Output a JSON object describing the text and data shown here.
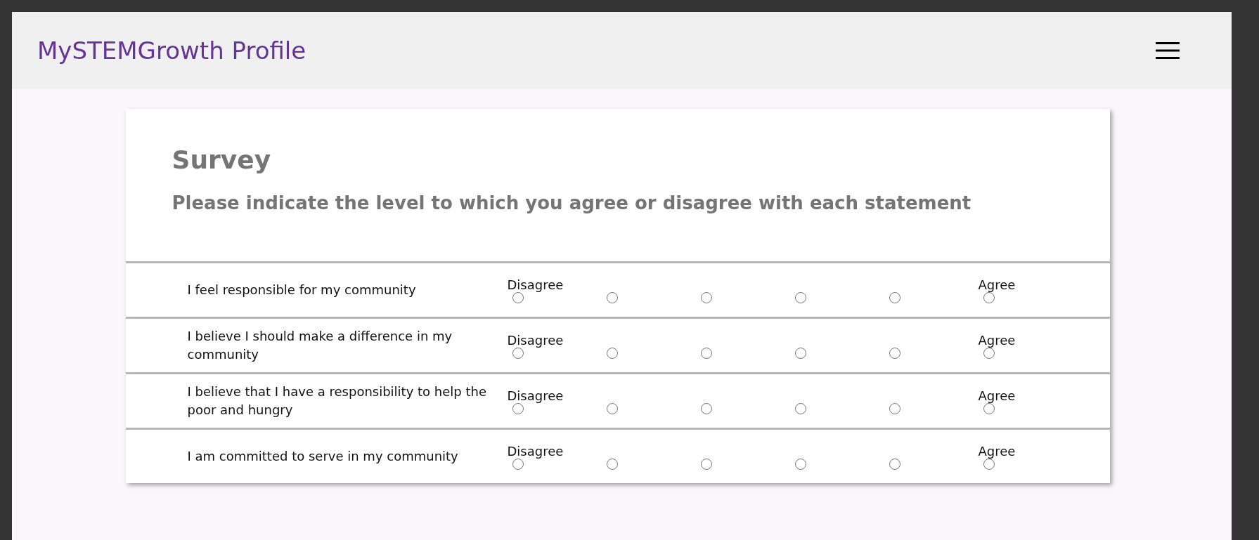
{
  "header": {
    "title": "MySTEMGrowth Profile"
  },
  "survey": {
    "title": "Survey",
    "instruction": "Please indicate the level to which you agree or disagree with each statement",
    "rows": [
      {
        "statement": "I feel responsible for my community",
        "low_label": "Disagree",
        "high_label": "Agree",
        "options": [
          {
            "selected": false
          },
          {
            "selected": false
          },
          {
            "selected": false
          },
          {
            "selected": false
          },
          {
            "selected": false
          },
          {
            "selected": false
          }
        ]
      },
      {
        "statement": "I believe I should make a difference in my community",
        "low_label": "Disagree",
        "high_label": "Agree",
        "options": [
          {
            "selected": false
          },
          {
            "selected": false
          },
          {
            "selected": false
          },
          {
            "selected": false
          },
          {
            "selected": false
          },
          {
            "selected": false
          }
        ]
      },
      {
        "statement": "I believe that I have a responsibility to help the poor and hungry",
        "low_label": "Disagree",
        "high_label": "Agree",
        "options": [
          {
            "selected": false
          },
          {
            "selected": false
          },
          {
            "selected": false
          },
          {
            "selected": false
          },
          {
            "selected": false
          },
          {
            "selected": false
          }
        ]
      },
      {
        "statement": "I am committed to serve in my community",
        "low_label": "Disagree",
        "high_label": "Agree",
        "options": [
          {
            "selected": false
          },
          {
            "selected": false
          },
          {
            "selected": false
          },
          {
            "selected": false
          },
          {
            "selected": false
          },
          {
            "selected": false
          }
        ]
      }
    ]
  }
}
